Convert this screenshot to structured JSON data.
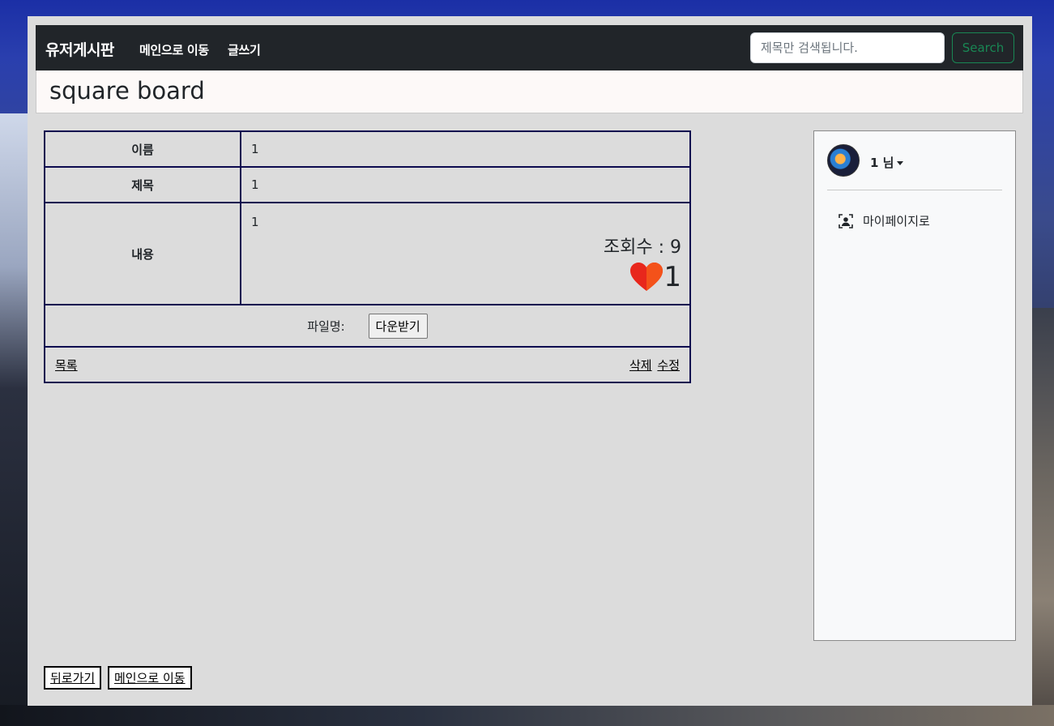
{
  "navbar": {
    "brand": "유저게시판",
    "links": [
      "메인으로 이동",
      "글쓰기"
    ],
    "search_placeholder": "제목만 검색됩니다.",
    "search_button": "Search"
  },
  "page_title": "square board",
  "post": {
    "name_label": "이름",
    "name_value": "1",
    "title_label": "제목",
    "title_value": "1",
    "content_label": "내용",
    "content_value": "1",
    "views_text": "조회수 : 9",
    "likes_count": "1",
    "file_label": "파일명:",
    "download_button": "다운받기",
    "list_link": "목록",
    "delete_link": "삭제",
    "edit_link": "수정"
  },
  "sidebar": {
    "user_name": "1 님",
    "mypage_link": "마이페이지로"
  },
  "bottom": {
    "back_button": "뒤로가기",
    "main_button": "메인으로 이동"
  },
  "colors": {
    "navbar_bg": "#212529",
    "search_accent": "#198754",
    "table_border": "#0d0a4f",
    "heart": "#e8271c"
  },
  "icons": [
    "heart-icon",
    "user-square-icon",
    "caret-down-icon"
  ]
}
